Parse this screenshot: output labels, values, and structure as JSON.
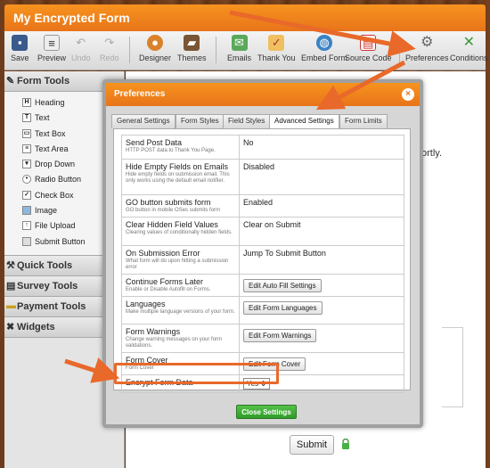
{
  "app": {
    "title": "My Encrypted Form"
  },
  "toolbar": {
    "items": [
      {
        "label": "Save"
      },
      {
        "label": "Preview"
      },
      {
        "label": "Undo"
      },
      {
        "label": "Redo"
      },
      {
        "label": "Designer"
      },
      {
        "label": "Themes"
      },
      {
        "label": "Emails"
      },
      {
        "label": "Thank You"
      },
      {
        "label": "Embed Form"
      },
      {
        "label": "Source Code"
      },
      {
        "label": "Preferences"
      },
      {
        "label": "Conditions"
      }
    ]
  },
  "sidebar": {
    "form_tools": "Form Tools",
    "items": [
      {
        "label": "Heading"
      },
      {
        "label": "Text"
      },
      {
        "label": "Text Box"
      },
      {
        "label": "Text Area"
      },
      {
        "label": "Drop Down"
      },
      {
        "label": "Radio Button"
      },
      {
        "label": "Check Box"
      },
      {
        "label": "Image"
      },
      {
        "label": "File Upload"
      },
      {
        "label": "Submit Button"
      }
    ],
    "sections": [
      {
        "label": "Quick Tools"
      },
      {
        "label": "Survey Tools"
      },
      {
        "label": "Payment Tools"
      },
      {
        "label": "Widgets"
      }
    ]
  },
  "canvas": {
    "partial_text": "ortly.",
    "submit_label": "Submit"
  },
  "dialog": {
    "title": "Preferences",
    "close_label": "×",
    "tabs": [
      {
        "label": "General Settings"
      },
      {
        "label": "Form Styles"
      },
      {
        "label": "Field Styles"
      },
      {
        "label": "Advanced Settings"
      },
      {
        "label": "Form Limits"
      }
    ],
    "rows": [
      {
        "name": "Send Post Data",
        "desc": "HTTP POST data to Thank You Page.",
        "value": "No"
      },
      {
        "name": "Hide Empty Fields on Emails",
        "desc": "Hide empty fields on submission email. This only works using the default email notifier.",
        "value": "Disabled"
      },
      {
        "name": "GO button submits form",
        "desc": "GO button in mobile OSes submits form",
        "value": "Enabled"
      },
      {
        "name": "Clear Hidden Field Values",
        "desc": "Clearing values of conditionally hidden fields.",
        "value": "Clear on Submit"
      },
      {
        "name": "On Submission Error",
        "desc": "What form will do upon hitting a submission error",
        "value": "Jump To Submit Button"
      },
      {
        "name": "Continue Forms Later",
        "desc": "Enable or Disable Autofill on Forms.",
        "value": "Edit Auto Fill Settings"
      },
      {
        "name": "Languages",
        "desc": "Make multiple language versions of your form.",
        "value": "Edit Form Languages"
      },
      {
        "name": "Form Warnings",
        "desc": "Change warning messages on your form validations.",
        "value": "Edit Form Warnings"
      },
      {
        "name": "Form Cover",
        "desc": "Form Cover",
        "value": "Edit Form Cover"
      },
      {
        "name": "Encrypt Form Data",
        "desc": "",
        "value": "Yes"
      }
    ],
    "close_settings_label": "Close Settings"
  },
  "colors": {
    "accent": "#e8741a",
    "highlight": "#e8692a",
    "green": "#2e9c28"
  }
}
